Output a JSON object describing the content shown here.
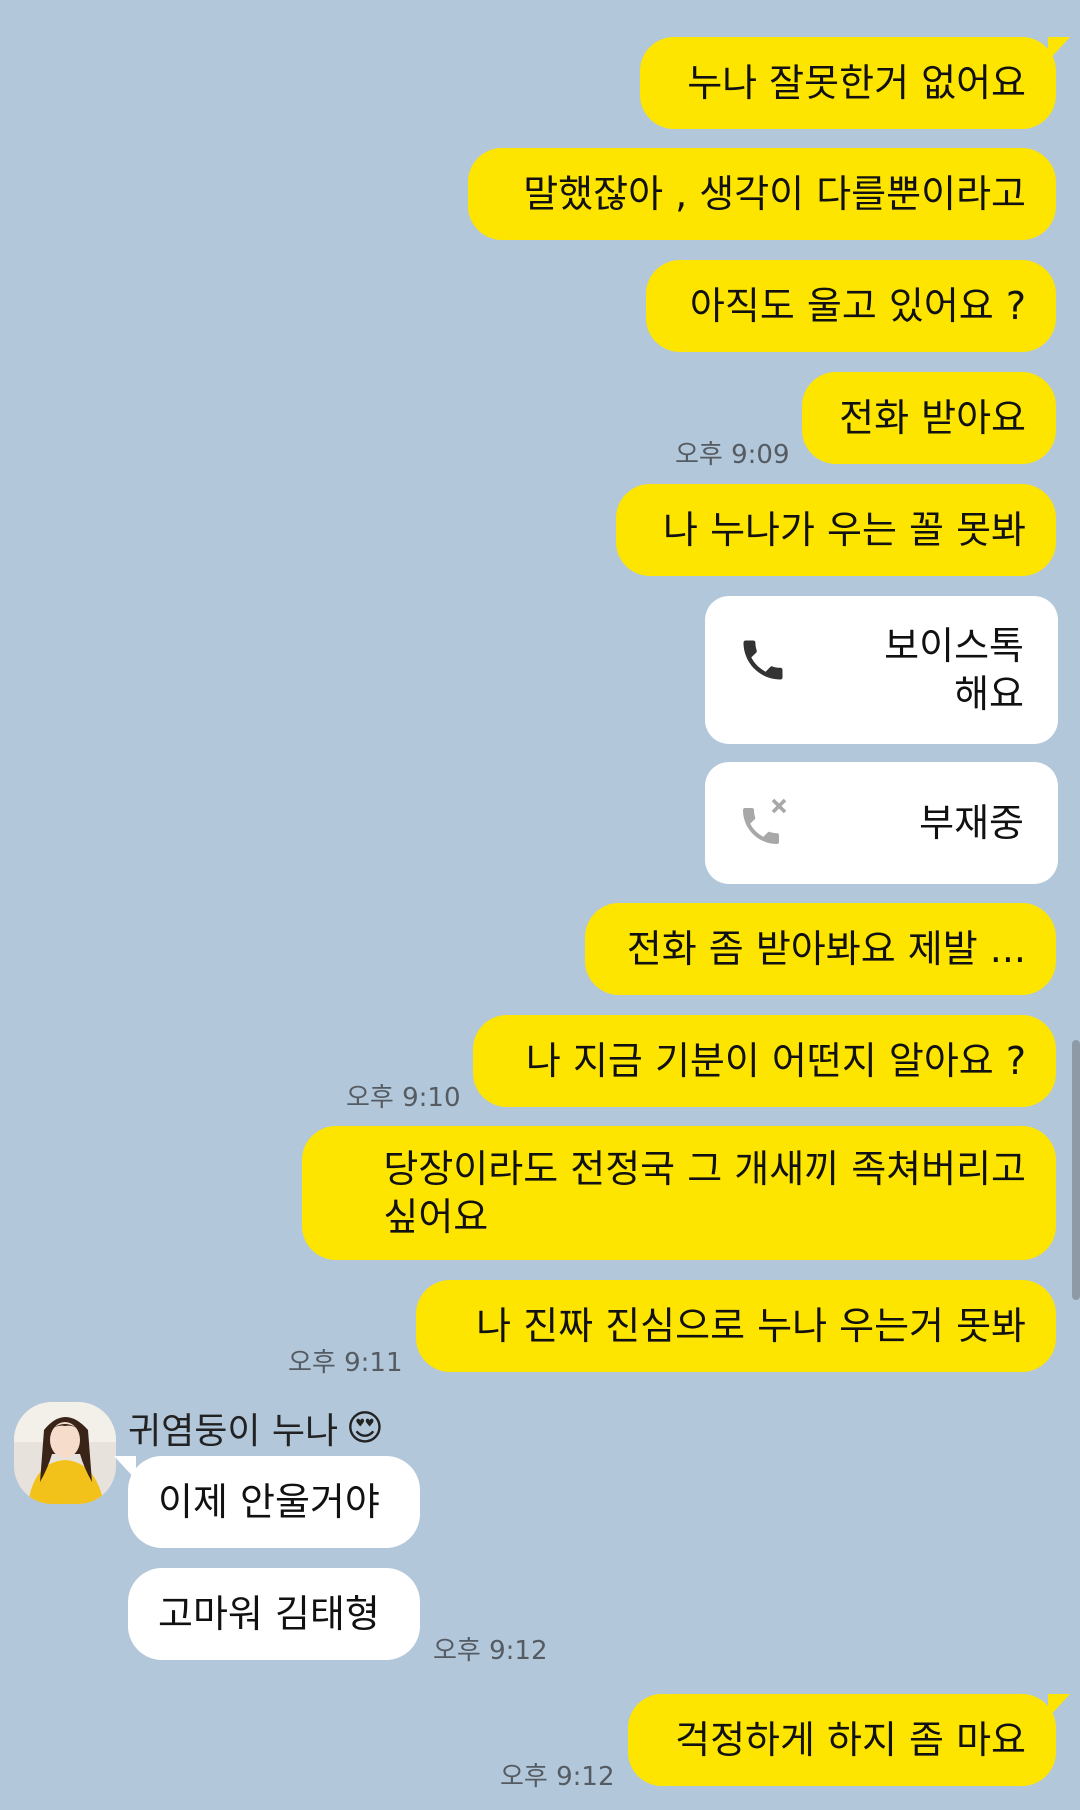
{
  "messages": {
    "m1": "누나 잘못한거 없어요",
    "m2": "말했잖아 , 생각이 다를뿐이라고",
    "m3": "아직도 울고 있어요 ?",
    "m4": "전화 받아요",
    "m5": "나 누나가 우는 꼴 못봐",
    "m6": "전화 좀 받아봐요 제발 ...",
    "m7": "나 지금 기분이 어떤지 알아요 ?",
    "m8": "당장이라도 전정국 그 개새끼 족쳐버리고\n싶어요",
    "m9": "나 진짜 진심으로 누나 우는거 못봐",
    "m10": "걱정하게 하지 좀 마요"
  },
  "calls": {
    "voice_label": "보이스톡\n해요",
    "missed_label": "부재중"
  },
  "times": {
    "t1": "오후 9:09",
    "t2": "오후 9:10",
    "t3": "오후 9:11",
    "t4": "오후 9:12",
    "t5": "오후 9:12"
  },
  "friend": {
    "name": "귀염둥이 누나",
    "emoji": "😍",
    "messages": [
      "이제 안울거야",
      "고마워 김태형"
    ]
  },
  "colors": {
    "background": "#b2c7d9",
    "outgoing_bubble": "#fee500",
    "incoming_bubble": "#ffffff"
  }
}
